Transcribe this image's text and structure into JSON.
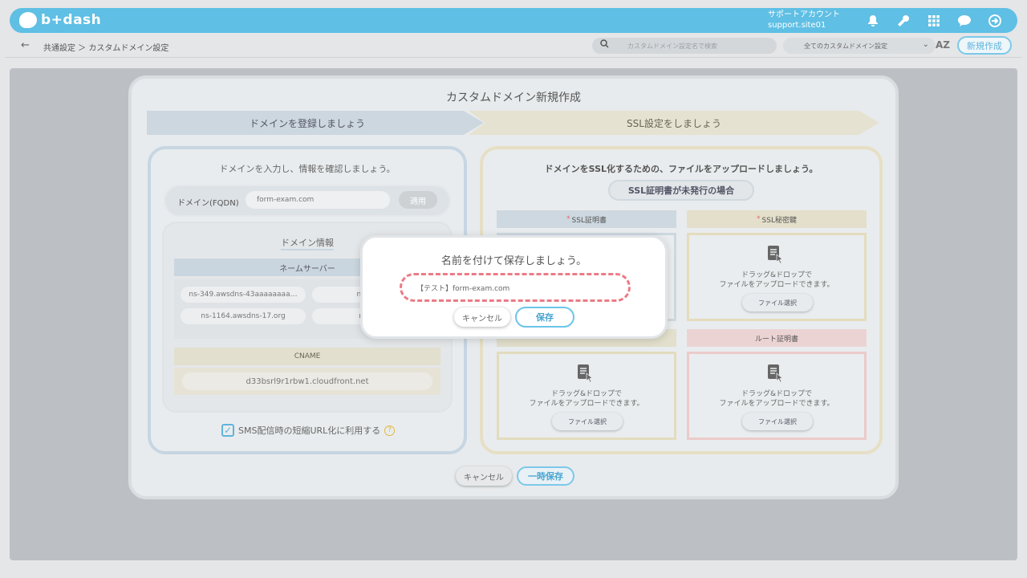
{
  "header": {
    "logo_text": "b+dash",
    "account_name": "サポートアカウント",
    "account_id": "support.site01"
  },
  "subbar": {
    "breadcrumb": "共通設定 ＞ カスタムドメイン設定",
    "search_placeholder": "カスタムドメイン設定名で検索",
    "filter_label": "全てのカスタムドメイン設定",
    "sort_label": "AZ",
    "new_button": "新規作成"
  },
  "modal": {
    "title": "カスタムドメイン新規作成",
    "step1": "ドメインを登録しましょう",
    "step2": "SSL設定をしましょう",
    "left": {
      "description": "ドメインを入力し、情報を確認しましょう。",
      "fqdn_label": "ドメイン(FQDN)",
      "fqdn_value": "form-exam.com",
      "apply_button": "適用",
      "info_title": "ドメイン情報",
      "nameserver_header": "ネームサーバー",
      "nameservers": [
        "ns-349.awsdns-43aaaaaaaa…",
        "ns-1581.a",
        "ns-1164.awsdns-17.org",
        "ns-427.a"
      ],
      "cname_header": "CNAME",
      "cname_value": "d33bsrl9r1rbw1.cloudfront.net",
      "sms_label": "SMS配信時の短縮URL化に利用する",
      "sms_checked": true
    },
    "right": {
      "description": "ドメインをSSL化するための、ファイルをアップロードしましょう。",
      "ssl_unissued_button": "SSL証明書が未発行の場合",
      "ssl_cert_label": "SSL証明書",
      "ssl_key_label": "SSL秘密鍵",
      "root_cert_label": "ルート証明書",
      "drop_text_1": "ドラッグ&ドロップで",
      "drop_text_2": "ファイルをアップロードできます。",
      "file_select_button": "ファイル選択"
    },
    "cancel_button": "キャンセル",
    "temp_save_button": "一時保存"
  },
  "dialog": {
    "title": "名前を付けて保存しましょう。",
    "name_value": "【テスト】form-exam.com",
    "cancel_button": "キャンセル",
    "save_button": "保存"
  },
  "colors": {
    "brand": "#5fbfe4",
    "accent_blue": "#7cc8ea",
    "highlight_red": "#ec7b86",
    "step1_bg": "#ccd7df",
    "step2_bg": "#e6e2d1"
  }
}
